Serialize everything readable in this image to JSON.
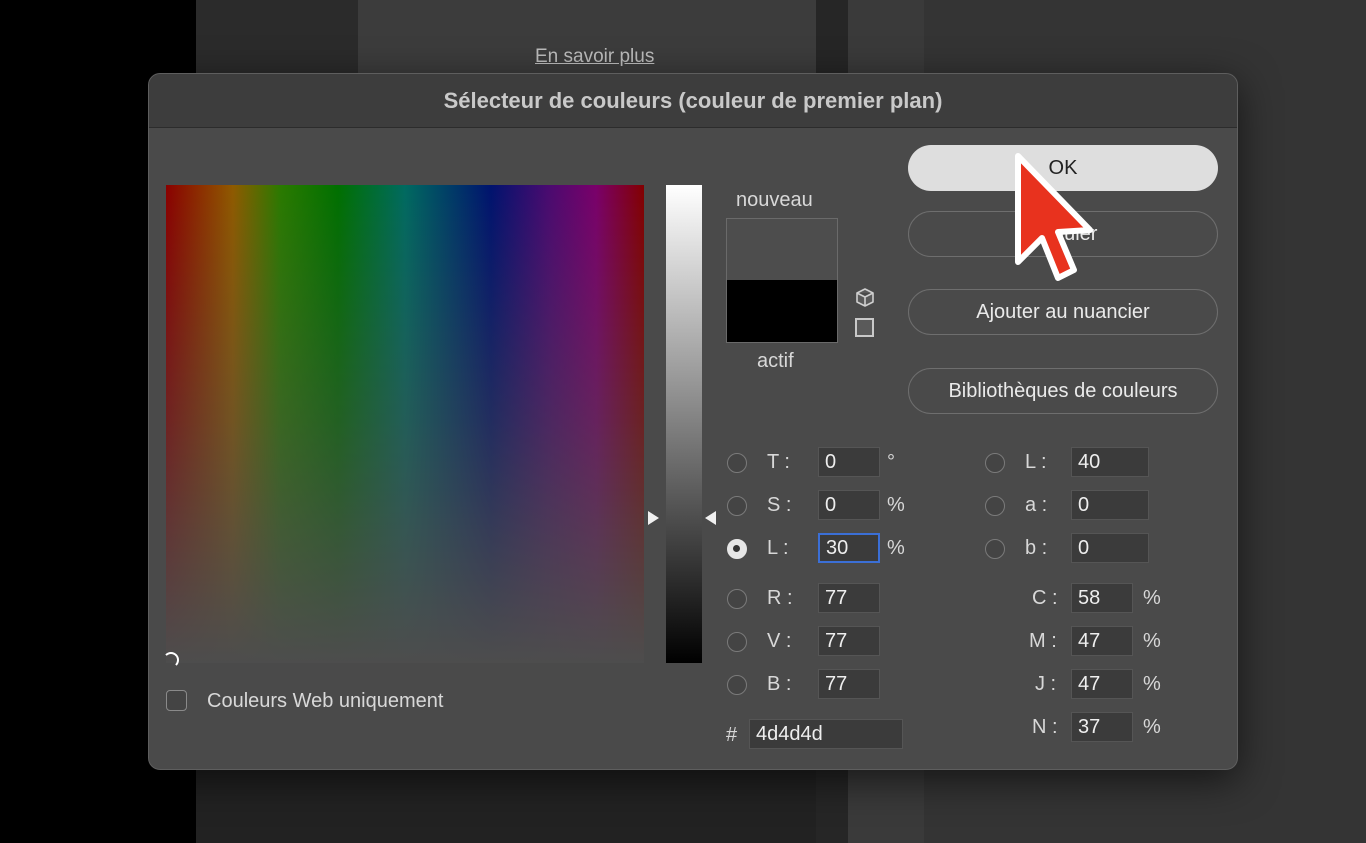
{
  "background": {
    "learn_more": "En savoir plus"
  },
  "dialog": {
    "title": "Sélecteur de couleurs (couleur de premier plan)",
    "new_label": "nouveau",
    "active_label": "actif",
    "new_color": "#4d4d4d",
    "active_color": "#000000",
    "buttons": {
      "ok": "OK",
      "cancel": "Annuler",
      "add_swatch": "Ajouter au nuancier",
      "libraries": "Bibliothèques de couleurs"
    },
    "hsb": [
      {
        "label": "T :",
        "value": "0",
        "unit": "°",
        "selected": false
      },
      {
        "label": "S :",
        "value": "0",
        "unit": "%",
        "selected": false
      },
      {
        "label": "L :",
        "value": "30",
        "unit": "%",
        "selected": true
      }
    ],
    "rgb": [
      {
        "label": "R :",
        "value": "77"
      },
      {
        "label": "V :",
        "value": "77"
      },
      {
        "label": "B :",
        "value": "77"
      }
    ],
    "lab": [
      {
        "label": "L :",
        "value": "40"
      },
      {
        "label": "a :",
        "value": "0"
      },
      {
        "label": "b :",
        "value": "0"
      }
    ],
    "cmyk": [
      {
        "label": "C :",
        "value": "58",
        "unit": "%"
      },
      {
        "label": "M :",
        "value": "47",
        "unit": "%"
      },
      {
        "label": "J :",
        "value": "47",
        "unit": "%"
      },
      {
        "label": "N :",
        "value": "37",
        "unit": "%"
      }
    ],
    "hex_prefix": "#",
    "hex": "4d4d4d",
    "web_only_label": "Couleurs Web uniquement",
    "web_only_checked": false,
    "accent_color": "#3b6fd6",
    "cursor_color": "#e8321e"
  }
}
